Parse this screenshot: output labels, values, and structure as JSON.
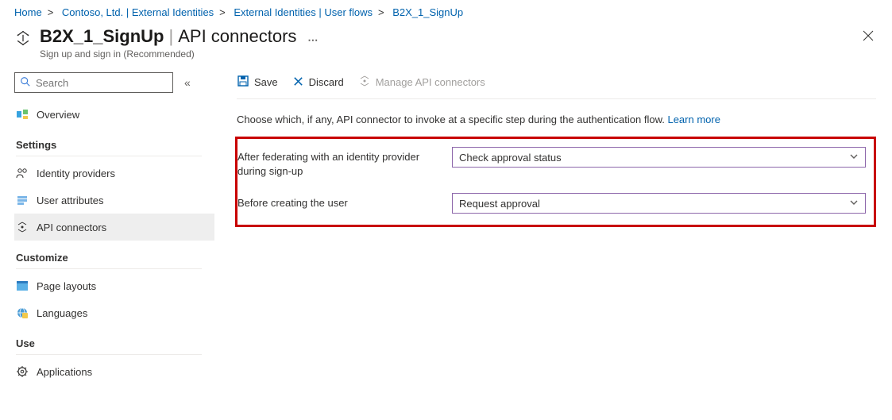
{
  "breadcrumb": [
    "Home",
    "Contoso, Ltd. | External Identities",
    "External Identities | User flows",
    "B2X_1_SignUp"
  ],
  "header": {
    "title_bold": "B2X_1_SignUp",
    "title_rest": "API connectors",
    "subtitle": "Sign up and sign in (Recommended)"
  },
  "search": {
    "placeholder": "Search"
  },
  "sidebar": {
    "overview": "Overview",
    "sections": [
      {
        "title": "Settings",
        "items": [
          "Identity providers",
          "User attributes",
          "API connectors"
        ],
        "active": 2
      },
      {
        "title": "Customize",
        "items": [
          "Page layouts",
          "Languages"
        ]
      },
      {
        "title": "Use",
        "items": [
          "Applications"
        ]
      }
    ]
  },
  "toolbar": {
    "save": "Save",
    "discard": "Discard",
    "manage": "Manage API connectors"
  },
  "main": {
    "desc": "Choose which, if any, API connector to invoke at a specific step during the authentication flow. ",
    "learn": "Learn more",
    "rows": [
      {
        "label": "After federating with an identity provider during sign-up",
        "value": "Check approval status"
      },
      {
        "label": "Before creating the user",
        "value": "Request approval"
      }
    ]
  }
}
